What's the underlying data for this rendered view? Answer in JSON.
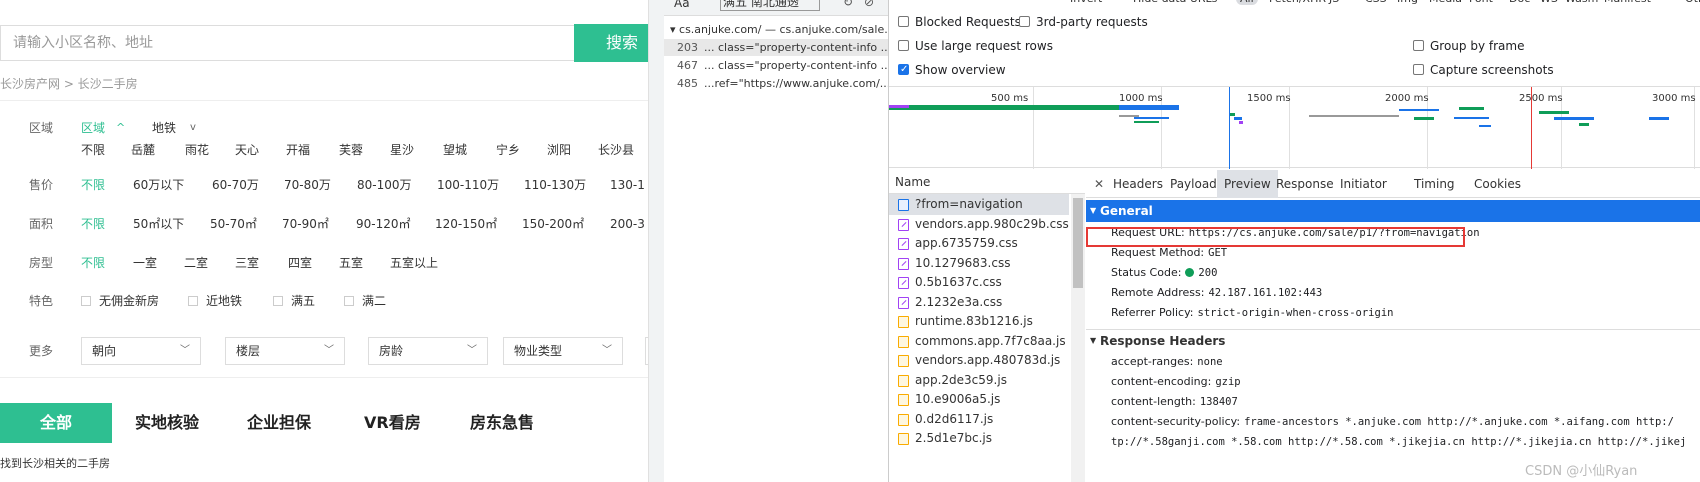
{
  "site": {
    "search_placeholder": "请输入小区名称、地址",
    "search_button": "搜索",
    "breadcrumb": "长沙房产网 > 长沙二手房",
    "filters": {
      "region": {
        "label": "区域",
        "tab_area": "区域",
        "tab_area_arrow": "^",
        "tab_subway": "地铁",
        "tab_subway_arrow": "v",
        "options": [
          "不限",
          "岳麓",
          "雨花",
          "天心",
          "开福",
          "芙蓉",
          "星沙",
          "望城",
          "宁乡",
          "浏阳",
          "长沙县"
        ]
      },
      "price": {
        "label": "售价",
        "options": [
          "不限",
          "60万以下",
          "60-70万",
          "70-80万",
          "80-100万",
          "100-110万",
          "110-130万",
          "130-1"
        ]
      },
      "area": {
        "label": "面积",
        "options": [
          "不限",
          "50㎡以下",
          "50-70㎡",
          "70-90㎡",
          "90-120㎡",
          "120-150㎡",
          "150-200㎡",
          "200-3"
        ]
      },
      "room": {
        "label": "房型",
        "options": [
          "不限",
          "一室",
          "二室",
          "三室",
          "四室",
          "五室",
          "五室以上"
        ]
      },
      "feature": {
        "label": "特色",
        "options": [
          "无佣金新房",
          "近地铁",
          "满五",
          "满二"
        ]
      },
      "more": {
        "label": "更多",
        "dropdowns": [
          "朝向",
          "楼层",
          "房龄",
          "物业类型"
        ]
      }
    },
    "tabs": [
      "全部",
      "实地核验",
      "企业担保",
      "VR看房",
      "房东急售"
    ],
    "found_text": "找到长沙相关的二手房"
  },
  "sources": {
    "aa": "Aa",
    "search_value": "满五 南北通透",
    "path": "▾ cs.anjuke.com/ — cs.anjuke.com/sale...",
    "rows": [
      {
        "line": "203",
        "text": "... class=\"property-content-info ..."
      },
      {
        "line": "467",
        "text": "... class=\"property-content-info ..."
      },
      {
        "line": "485",
        "text": "...ref=\"https://www.anjuke.com/..."
      }
    ]
  },
  "network": {
    "types": [
      "Invert",
      "Hide data URLs",
      "All",
      "Fetch/XHR",
      "JS",
      "CSS",
      "Img",
      "Media",
      "Font",
      "Doc",
      "WS",
      "Wasm",
      "Manifest",
      "Other"
    ],
    "options": {
      "blocked_requests": "Blocked Requests",
      "third_party": "3rd-party requests",
      "large_rows": "Use large request rows",
      "show_overview": "Show overview",
      "group_by_frame": "Group by frame",
      "capture_screenshots": "Capture screenshots"
    },
    "timeline_ticks": [
      "500 ms",
      "1000 ms",
      "1500 ms",
      "2000 ms",
      "2500 ms",
      "3000 ms"
    ],
    "name_header": "Name",
    "requests": [
      {
        "name": "?from=navigation",
        "type": "doc"
      },
      {
        "name": "vendors.app.980c29b.css",
        "type": "css"
      },
      {
        "name": "app.6735759.css",
        "type": "css"
      },
      {
        "name": "10.1279683.css",
        "type": "css"
      },
      {
        "name": "0.5b1637c.css",
        "type": "css"
      },
      {
        "name": "2.1232e3a.css",
        "type": "css"
      },
      {
        "name": "runtime.83b1216.js",
        "type": "js"
      },
      {
        "name": "commons.app.7f7c8aa.js",
        "type": "js"
      },
      {
        "name": "vendors.app.480783d.js",
        "type": "js"
      },
      {
        "name": "app.2de3c59.js",
        "type": "js"
      },
      {
        "name": "10.e9006a5.js",
        "type": "js"
      },
      {
        "name": "0.d2d6117.js",
        "type": "js"
      },
      {
        "name": "2.5d1e7bc.js",
        "type": "js"
      }
    ],
    "detail_tabs": [
      "Headers",
      "Payload",
      "Preview",
      "Response",
      "Initiator",
      "Timing",
      "Cookies"
    ],
    "general": {
      "title": "General",
      "request_url_k": "Request URL:",
      "request_url_v": "https://cs.anjuke.com/sale/p1/?from=navigation",
      "method_k": "Request Method:",
      "method_v": "GET",
      "status_k": "Status Code:",
      "status_v": "200",
      "remote_k": "Remote Address:",
      "remote_v": "42.187.161.102:443",
      "referrer_k": "Referrer Policy:",
      "referrer_v": "strict-origin-when-cross-origin"
    },
    "response": {
      "title": "Response Headers",
      "h1_k": "accept-ranges:",
      "h1_v": "none",
      "h2_k": "content-encoding:",
      "h2_v": "gzip",
      "h3_k": "content-length:",
      "h3_v": "138407",
      "h4_k": "content-security-policy:",
      "h4_v": "frame-ancestors *.anjuke.com http://*.anjuke.com *.aifang.com http:/",
      "h5_v": "tp://*.58ganji.com *.58.com http://*.58.com *.jikejia.cn http://*.jikejia.cn http://*.jikej"
    }
  },
  "watermark": "CSDN @小仙Ryan"
}
